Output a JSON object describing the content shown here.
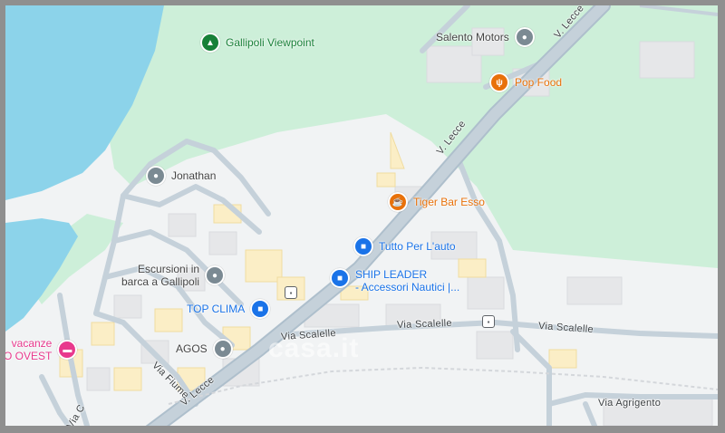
{
  "map": {
    "colors": {
      "water": "#8cd3ea",
      "park": "#cdefd9",
      "land": "#f1f3f4",
      "road": "#c5d1da",
      "road_edge": "#aebfcc",
      "building": "#e6e7e9",
      "building_yellow": "#fbeec6"
    },
    "pois": [
      {
        "key": "gallipoli-viewpoint",
        "label": "Gallipoli Viewpoint",
        "icon": "viewpoint-icon",
        "color": "green"
      },
      {
        "key": "salento-motors",
        "label": "Salento Motors",
        "icon": "place-icon",
        "color": "grey"
      },
      {
        "key": "pop-food",
        "label": "Pop Food",
        "icon": "restaurant-icon",
        "color": "orange"
      },
      {
        "key": "jonathan",
        "label": "Jonathan",
        "icon": "place-icon",
        "color": "grey"
      },
      {
        "key": "tiger-bar-esso",
        "label": "Tiger Bar Esso",
        "icon": "cafe-icon",
        "color": "orange"
      },
      {
        "key": "tutto-per-lauto",
        "label": "Tutto Per L'auto",
        "icon": "shopping-icon",
        "color": "blue"
      },
      {
        "key": "ship-leader-l1",
        "label": "SHIP LEADER",
        "icon": "shopping-icon",
        "color": "blue"
      },
      {
        "key": "ship-leader-l2",
        "label": "- Accessori Nautici |...",
        "icon": "",
        "color": "blue"
      },
      {
        "key": "escursioni-l1",
        "label": "Escursioni in",
        "icon": "place-icon",
        "color": "grey"
      },
      {
        "key": "escursioni-l2",
        "label": "barca a Gallipoli",
        "icon": "",
        "color": "grey"
      },
      {
        "key": "top-clima",
        "label": "TOP CLIMA",
        "icon": "shopping-icon",
        "color": "blue"
      },
      {
        "key": "agos",
        "label": "AGOS",
        "icon": "place-icon",
        "color": "grey"
      },
      {
        "key": "vacanze-l1",
        "label": "vacanze",
        "icon": "hotel-icon",
        "color": "pink"
      },
      {
        "key": "vacanze-l2",
        "label": "O OVEST",
        "icon": "",
        "color": "pink"
      }
    ],
    "streets": {
      "v_lecce_top": "V. Lecce",
      "v_lecce_mid": "V. Lecce",
      "v_lecce_bottom": "V. Lecce",
      "via_scalelle_1": "Via Scalelle",
      "via_scalelle_2": "Via Scalelle",
      "via_scalelle_3": "Via Scalelle",
      "via_fiume": "Via Fiume",
      "via_agrigento": "Via Agrigento",
      "via_c": "Via C"
    },
    "watermark": "casa.it"
  }
}
